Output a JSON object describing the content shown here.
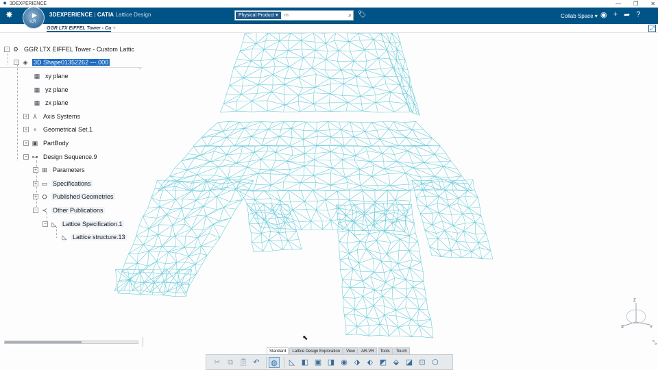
{
  "os": {
    "title": "3DEXPERIENCE",
    "logo_icon": "ds-logo-icon",
    "controls": [
      "—",
      "❐",
      "✕"
    ]
  },
  "header": {
    "brand_bold": "3DEXPERIENCE",
    "brand_sep": " | ",
    "brand_app": "CATIA",
    "brand_module": " Lattice Design",
    "compass_label": "V,R",
    "search_scope": "Physical Product ▾",
    "search_value": "",
    "search_placeholder": "m",
    "search_icon": "search-icon",
    "collab_space": "Collab Space ▾",
    "bg_color": "#005386"
  },
  "tabs": {
    "active_doc": "GGR LTX EIFFEL Tower - Cu",
    "add_label": "+"
  },
  "tree": {
    "root": "GGR LTX EIFFEL Tower - Custom Lattic",
    "shape": "3D Shape01352262 ---.000",
    "items": [
      {
        "label": "xy plane"
      },
      {
        "label": "yz plane"
      },
      {
        "label": "zx plane"
      },
      {
        "label": "Axis Systems"
      },
      {
        "label": "Geometrical Set.1"
      },
      {
        "label": "PartBody"
      },
      {
        "label": "Design Sequence.9"
      },
      {
        "label": "Parameters"
      },
      {
        "label": "Specifications"
      },
      {
        "label": "Published Geometries"
      },
      {
        "label": "Other Publications"
      },
      {
        "label": "Lattice Specification.1"
      },
      {
        "label": "Lattice structure.13"
      }
    ],
    "selection_color": "#1d6bc1"
  },
  "viewport": {
    "mesh_color": "#4fc3d4"
  },
  "axes": {
    "x": "X",
    "y": "Y",
    "z": "Z"
  },
  "workbench_tabs": [
    {
      "label": "Standard"
    },
    {
      "label": "Lattice Design Exploration"
    },
    {
      "label": "View"
    },
    {
      "label": "AR-VR"
    },
    {
      "label": "Tools"
    },
    {
      "label": "Touch"
    }
  ]
}
